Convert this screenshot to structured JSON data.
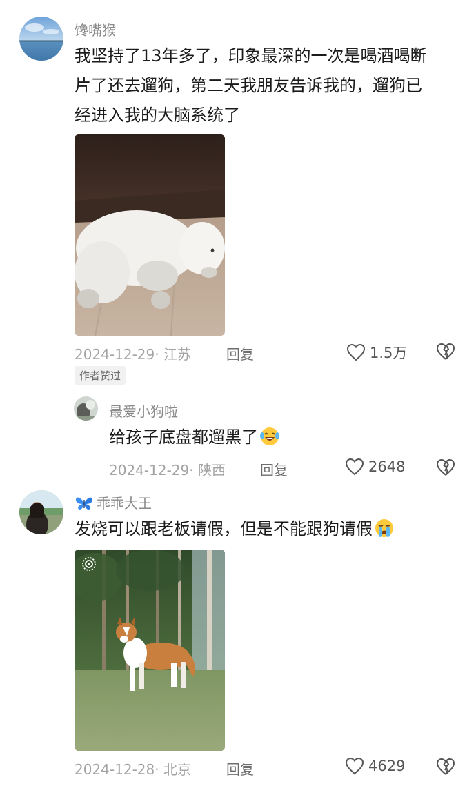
{
  "comments": [
    {
      "username": "馋嘴猴",
      "text_lines": [
        "我坚持了13年多了，印象最深的一次是喝酒喝断",
        "片了还去遛狗，第二天我朋友告诉我的，遛狗已",
        "经进入我的大脑系统了"
      ],
      "image_alt": "white poodle lying on wooden floor",
      "date_location": "2024-12-29· 江苏",
      "reply_label": "回复",
      "likes": "1.5万",
      "badge": "作者赞过"
    },
    {
      "username": "最爱小狗啦",
      "text": "给孩子底盘都遛黑了",
      "emoji": "laughing-tears-emoji",
      "date_location": "2024-12-29· 陕西",
      "reply_label": "回复",
      "likes": "2648"
    },
    {
      "username": "乖乖大王",
      "text": "发烧可以跟老板请假，但是不能跟狗请假",
      "emoji": "crying-emoji",
      "image_alt": "sable and white border collie standing in grass among trees",
      "date_location": "2024-12-28· 北京",
      "reply_label": "回复",
      "likes": "4629"
    }
  ],
  "colors": {
    "username": "#8a8a8a",
    "meta": "#a3a3a3",
    "text": "#1b1b1b",
    "badge_bg": "#f1f1f1"
  },
  "icons": [
    "heart-outline-icon",
    "broken-heart-icon",
    "butterfly-icon",
    "live-photo-icon"
  ]
}
